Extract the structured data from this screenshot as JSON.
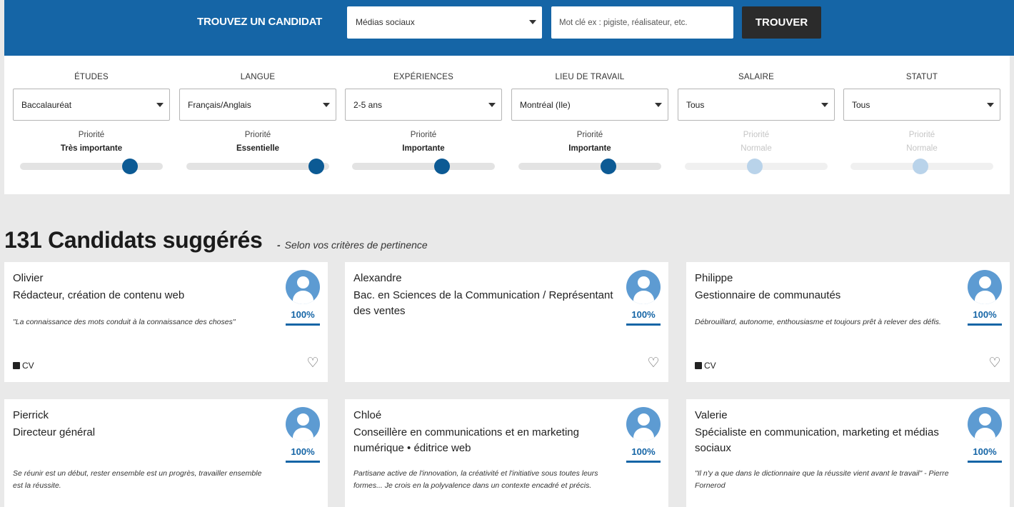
{
  "search": {
    "label": "TROUVEZ UN CANDIDAT",
    "category_value": "Médias sociaux",
    "keyword_placeholder": "Mot clé ex : pigiste, réalisateur, etc.",
    "button_label": "TROUVER"
  },
  "filters": [
    {
      "header": "ÉTUDES",
      "value": "Baccalauréat",
      "priority_label": "Priorité",
      "priority_value": "Très importante",
      "level": 0.77
    },
    {
      "header": "LANGUE",
      "value": "Français/Anglais",
      "priority_label": "Priorité",
      "priority_value": "Essentielle",
      "level": 0.91
    },
    {
      "header": "EXPÉRIENCES",
      "value": "2-5 ans",
      "priority_label": "Priorité",
      "priority_value": "Importante",
      "level": 0.63
    },
    {
      "header": "LIEU DE TRAVAIL",
      "value": "Montréal (Ile)",
      "priority_label": "Priorité",
      "priority_value": "Importante",
      "level": 0.63
    },
    {
      "header": "SALAIRE",
      "value": "Tous",
      "priority_label": "Priorité",
      "priority_value": "Normale",
      "level": 0.49
    },
    {
      "header": "STATUT",
      "value": "Tous",
      "priority_label": "Priorité",
      "priority_value": "Normale",
      "level": 0.49
    }
  ],
  "results": {
    "heading": "131 Candidats suggérés",
    "dash": "-",
    "subheading": "Selon vos critères de pertinence"
  },
  "candidates": [
    {
      "name": "Olivier",
      "title": "Rédacteur, création de contenu web",
      "quote": "\"La connaissance des mots conduit à la connaissance des choses\"",
      "match": "100%",
      "cv_label": "CV"
    },
    {
      "name": "Alexandre",
      "title": "Bac. en Sciences de la Communication / Représentant des ventes",
      "quote": "",
      "match": "100%",
      "cv_label": ""
    },
    {
      "name": "Philippe",
      "title": "Gestionnaire de communautés",
      "quote": "Débrouillard, autonome, enthousiasme et toujours prêt à relever des défis.",
      "match": "100%",
      "cv_label": "CV"
    },
    {
      "name": "Pierrick",
      "title": "Directeur général",
      "quote": "Se réunir est un début, rester ensemble est un progrès, travailler ensemble est la réussite.",
      "match": "100%",
      "cv_label": ""
    },
    {
      "name": "Chloé",
      "title": "Conseillère en communications et en marketing numérique • éditrice web",
      "quote": "Partisane active de l'innovation, la créativité et l'initiative sous toutes leurs formes... Je crois en la polyvalence dans un contexte encadré et précis.",
      "match": "100%",
      "cv_label": ""
    },
    {
      "name": "Valerie",
      "title": "Spécialiste en communication, marketing et médias sociaux",
      "quote": "\"Il n'y a que dans le dictionnaire que la réussite vient avant le travail\" - Pierre Fornerod",
      "match": "100%",
      "cv_label": ""
    }
  ],
  "colors": {
    "brand": "#1565a6",
    "slider_active": "#0c5a94",
    "slider_muted": "#b9d3ea",
    "search_button": "#2b2b2b"
  },
  "icons": [
    "caret-down-icon",
    "avatar-icon",
    "document-icon",
    "heart-icon"
  ]
}
